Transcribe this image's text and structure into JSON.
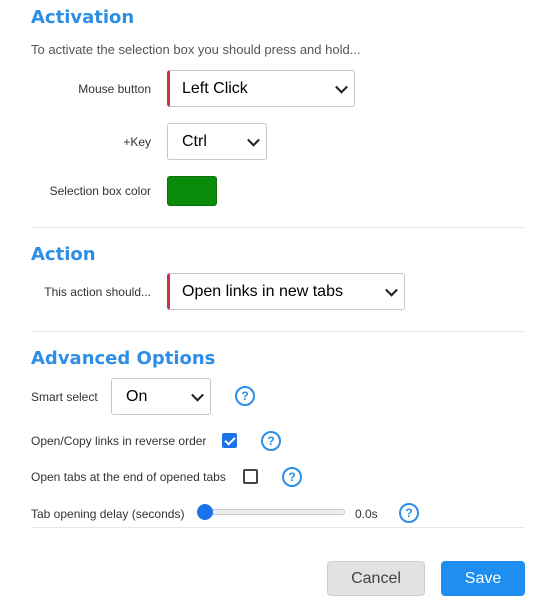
{
  "activation": {
    "title": "Activation",
    "subtitle": "To activate the selection box you should press and hold...",
    "mouse_button": {
      "label": "Mouse button",
      "value": "Left Click"
    },
    "key": {
      "label": "+Key",
      "value": "Ctrl"
    },
    "box_color": {
      "label": "Selection box color",
      "color": "#0a8a0a"
    }
  },
  "action": {
    "title": "Action",
    "label": "This action should...",
    "value": "Open links in new tabs"
  },
  "advanced": {
    "title": "Advanced Options",
    "smart_select": {
      "label": "Smart select",
      "value": "On",
      "help": "?"
    },
    "reverse_order": {
      "label": "Open/Copy links in reverse order",
      "checked": true,
      "help": "?"
    },
    "end_of_tabs": {
      "label": "Open tabs at the end of opened tabs",
      "checked": false,
      "help": "?"
    },
    "delay": {
      "label": "Tab opening delay (seconds)",
      "value_text": "0.0s",
      "value": 0.0,
      "help": "?"
    }
  },
  "buttons": {
    "cancel": "Cancel",
    "save": "Save"
  },
  "colors": {
    "accent": "#2e8ee6",
    "primary_button": "#1e8ef0",
    "required_marker": "#c9304b"
  }
}
